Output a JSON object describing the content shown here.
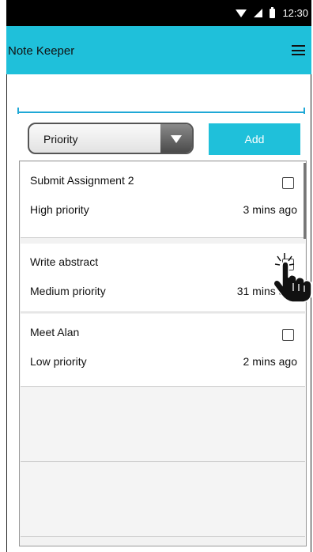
{
  "status_bar": {
    "time": "12:30"
  },
  "app_bar": {
    "title": "Note Keeper",
    "menu_icon": "hamburger-menu-icon"
  },
  "note_input": {
    "value": "",
    "placeholder": ""
  },
  "priority_select": {
    "selected": "Priority"
  },
  "add_button": {
    "label": "Add"
  },
  "notes": [
    {
      "title": "Submit Assignment 2",
      "priority": "High priority",
      "time": "3 mins ago",
      "checked": false
    },
    {
      "title": "Write abstract",
      "priority": "Medium priority",
      "time": "31 mins ago",
      "checked": false
    },
    {
      "title": "Meet Alan",
      "priority": "Low priority",
      "time": "2 mins ago",
      "checked": false
    }
  ],
  "colors": {
    "accent": "#1fc0da",
    "input_underline": "#1fa8d6"
  }
}
